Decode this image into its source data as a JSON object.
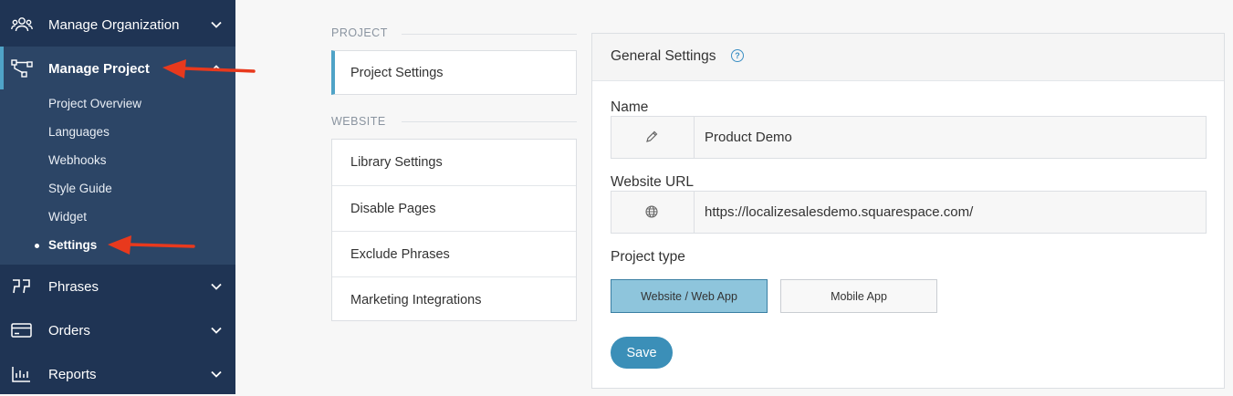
{
  "sidebar": {
    "items": [
      {
        "label": "Manage Organization",
        "icon": "people-icon"
      },
      {
        "label": "Manage Project",
        "icon": "project-tree-icon"
      },
      {
        "label": "Phrases",
        "icon": "quote-icon"
      },
      {
        "label": "Orders",
        "icon": "credit-card-icon"
      },
      {
        "label": "Reports",
        "icon": "bar-chart-icon"
      }
    ],
    "subitems": [
      "Project Overview",
      "Languages",
      "Webhooks",
      "Style Guide",
      "Widget",
      "Settings"
    ]
  },
  "settings_nav": {
    "project_section": "PROJECT",
    "project_items": [
      "Project Settings"
    ],
    "website_section": "WEBSITE",
    "website_items": [
      "Library Settings",
      "Disable Pages",
      "Exclude Phrases",
      "Marketing Integrations"
    ]
  },
  "general": {
    "title": "General Settings",
    "help": "?",
    "name_label": "Name",
    "name_value": "Product Demo",
    "url_label": "Website URL",
    "url_value": "https://localizesalesdemo.squarespace.com/",
    "type_label": "Project type",
    "type_options": [
      "Website / Web App",
      "Mobile App"
    ],
    "selected_type": "Website / Web App",
    "save_label": "Save"
  },
  "colors": {
    "sidebar": "#1f3454",
    "accent": "#3b8fb8",
    "arrow": "#e8391d"
  }
}
